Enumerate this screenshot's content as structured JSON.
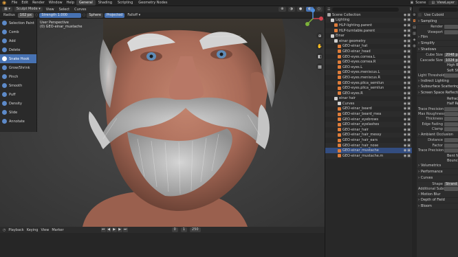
{
  "topbar": {
    "menus": [
      "File",
      "Edit",
      "Render",
      "Window",
      "Help"
    ],
    "tabs": [
      "General",
      "Shading",
      "Scripting",
      "Geometry Nodes"
    ],
    "active_tab": "General",
    "scene_label": "Scene",
    "view_layer": "ViewLayer"
  },
  "viewport_header": {
    "mode": "Sculpt Mode",
    "menus": [
      "View",
      "Select",
      "Curves"
    ]
  },
  "brush_header": {
    "radius_label": "Radius",
    "radius_value": "102 px",
    "strength_label": "Strength",
    "strength_value": "1.000",
    "sphere_label": "Sphere",
    "projected_label": "Projected",
    "falloff_label": "Falloff"
  },
  "overlay": {
    "line1": "User Perspective",
    "line2": "(0) GEO-einar_mustache"
  },
  "tools": [
    "Selection Paint",
    "Comb",
    "Add",
    "Delete",
    "Snake Hook",
    "Grow/Shrink",
    "Pinch",
    "Smooth",
    "Puff",
    "Density",
    "Slide",
    "Annotate"
  ],
  "active_tool": "Snake Hook",
  "timeline": {
    "menus": [
      "Playback",
      "Keying",
      "View",
      "Marker"
    ],
    "frame": "0",
    "start": "1",
    "end": "250"
  },
  "outliner": {
    "rows": [
      {
        "name": "Scene Collection",
        "indent": 0,
        "color": "#aaaaaa"
      },
      {
        "name": "Lighting",
        "indent": 1,
        "color": "#cfcfcf"
      },
      {
        "name": "HLP-lighting.parent",
        "indent": 2,
        "color": "#e07d3a"
      },
      {
        "name": "HLP-turntable.parent",
        "indent": 2,
        "color": "#e07d3a"
      },
      {
        "name": "Einar",
        "indent": 1,
        "color": "#cfcfcf"
      },
      {
        "name": "einar geometry",
        "indent": 2,
        "color": "#cfcfcf"
      },
      {
        "name": "GEO-einar_hat",
        "indent": 3,
        "color": "#e07d3a"
      },
      {
        "name": "GEO-einar_head",
        "indent": 3,
        "color": "#e07d3a"
      },
      {
        "name": "GEO-eyes.cornea.L",
        "indent": 3,
        "color": "#e07d3a"
      },
      {
        "name": "GEO-eyes.cornea.R",
        "indent": 3,
        "color": "#e07d3a"
      },
      {
        "name": "GEO-eyes.L",
        "indent": 3,
        "color": "#e07d3a"
      },
      {
        "name": "GEO-eyes.meniscus.L",
        "indent": 3,
        "color": "#e07d3a"
      },
      {
        "name": "GEO-eyes.meniscus.R",
        "indent": 3,
        "color": "#e07d3a"
      },
      {
        "name": "GEO-eyes.plica_semilun",
        "indent": 3,
        "color": "#e07d3a"
      },
      {
        "name": "GEO-eyes.plica_semilun",
        "indent": 3,
        "color": "#e07d3a"
      },
      {
        "name": "GEO-eyes.R",
        "indent": 3,
        "color": "#e07d3a"
      },
      {
        "name": "einar hair",
        "indent": 2,
        "color": "#cfcfcf"
      },
      {
        "name": "Curves",
        "indent": 3,
        "color": "#cfcfcf"
      },
      {
        "name": "GEO-einar_beard",
        "indent": 3,
        "color": "#e07d3a"
      },
      {
        "name": "GEO-einar_beard_mea",
        "indent": 3,
        "color": "#e07d3a"
      },
      {
        "name": "GEO-einar_eyebrows",
        "indent": 3,
        "color": "#e07d3a"
      },
      {
        "name": "GEO-einar_eyelashes",
        "indent": 3,
        "color": "#e07d3a"
      },
      {
        "name": "GEO-einar_hair",
        "indent": 3,
        "color": "#e07d3a"
      },
      {
        "name": "GEO-einar_hair_messy",
        "indent": 3,
        "color": "#e07d3a"
      },
      {
        "name": "GEO-einar_hair_ears",
        "indent": 3,
        "color": "#e07d3a"
      },
      {
        "name": "GEO-einar_hair_nose",
        "indent": 3,
        "color": "#e07d3a"
      },
      {
        "name": "GEO-einar_mustache",
        "indent": 3,
        "color": "#e07d3a",
        "highlight": true
      },
      {
        "name": "GEO-einar_mustache.m",
        "indent": 3,
        "color": "#e07d3a"
      }
    ]
  },
  "properties": {
    "engine_label": "Use Cuboid",
    "sections": [
      {
        "type": "section",
        "label": "Sampling"
      },
      {
        "type": "row",
        "key": "Render",
        "value": ""
      },
      {
        "type": "row",
        "key": "Viewport",
        "value": ""
      },
      {
        "type": "section",
        "label": "Film"
      },
      {
        "type": "section",
        "label": "Simplify"
      },
      {
        "type": "section",
        "label": "Shadows"
      },
      {
        "type": "row",
        "key": "Cube Size",
        "value": "2048 px"
      },
      {
        "type": "row",
        "key": "Cascade Size",
        "value": "1024 px"
      },
      {
        "type": "check",
        "label": "High Bit"
      },
      {
        "type": "check",
        "label": "Soft Shad"
      },
      {
        "type": "row",
        "key": "Light Threshold",
        "value": ""
      },
      {
        "type": "section",
        "label": "Indirect Lighting"
      },
      {
        "type": "section",
        "label": "Subsurface Scattering"
      },
      {
        "type": "section",
        "label": "Screen Space Reflections"
      },
      {
        "type": "check",
        "label": "Refraction"
      },
      {
        "type": "check",
        "label": "Half Res"
      },
      {
        "type": "row",
        "key": "Trace Precision",
        "value": ""
      },
      {
        "type": "row",
        "key": "Max Roughness",
        "value": ""
      },
      {
        "type": "row",
        "key": "Thickness",
        "value": ""
      },
      {
        "type": "row",
        "key": "Edge Fading",
        "value": ""
      },
      {
        "type": "row",
        "key": "Clamp",
        "value": ""
      },
      {
        "type": "section",
        "label": "Ambient Occlusion"
      },
      {
        "type": "row",
        "key": "Distance",
        "value": ""
      },
      {
        "type": "row",
        "key": "Factor",
        "value": ""
      },
      {
        "type": "row",
        "key": "Trace Precision",
        "value": ""
      },
      {
        "type": "check",
        "label": "Bent Nor"
      },
      {
        "type": "check",
        "label": "Bounces"
      },
      {
        "type": "section",
        "label": "Volumetrics"
      },
      {
        "type": "section",
        "label": "Performance"
      },
      {
        "type": "section",
        "label": "Curves"
      },
      {
        "type": "row",
        "key": "Shape",
        "value": "Strand"
      },
      {
        "type": "row",
        "key": "Additional Subdivis",
        "value": ""
      },
      {
        "type": "section",
        "label": "Motion Blur"
      },
      {
        "type": "section",
        "label": "Depth of Field"
      },
      {
        "type": "section",
        "label": "Bloom"
      }
    ]
  }
}
